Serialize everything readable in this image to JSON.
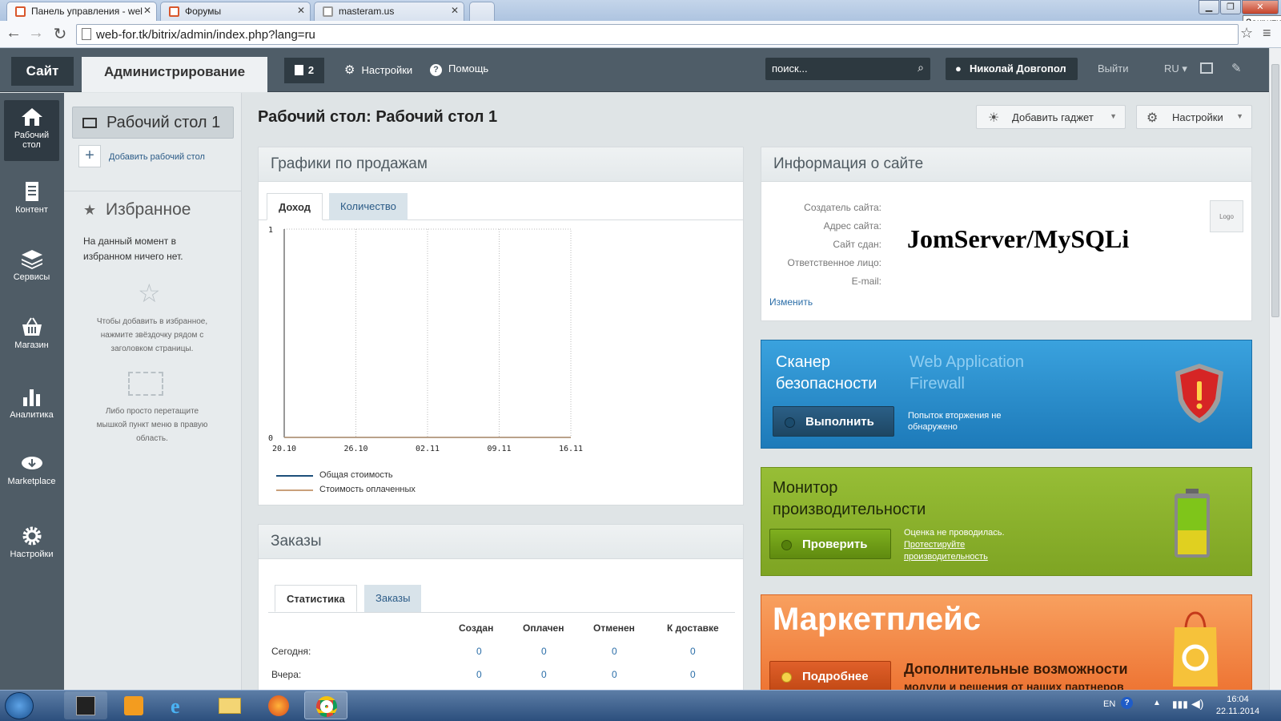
{
  "browser": {
    "tabs": [
      {
        "label": "Панель управления - wel",
        "close": "✕"
      },
      {
        "label": "Форумы",
        "close": "✕"
      },
      {
        "label": "masteram.us",
        "close": "✕"
      }
    ],
    "url": "web-for.tk/bitrix/admin/index.php?lang=ru",
    "close_tooltip": "Закрити"
  },
  "topbar": {
    "site_button": "Сайт",
    "admin_tab": "Администрирование",
    "notifications_count": "2",
    "settings": "Настройки",
    "help": "Помощь",
    "search_placeholder": "поиск...",
    "user": "Николай Довгопол",
    "logout": "Выйти",
    "language": "RU"
  },
  "leftnav": [
    {
      "label": "Рабочий стол",
      "icon": "home-icon"
    },
    {
      "label": "Контент",
      "icon": "document-icon"
    },
    {
      "label": "Сервисы",
      "icon": "layers-icon"
    },
    {
      "label": "Магазин",
      "icon": "basket-icon"
    },
    {
      "label": "Аналитика",
      "icon": "bar-chart-icon"
    },
    {
      "label": "Marketplace",
      "icon": "cloud-download-icon"
    },
    {
      "label": "Настройки",
      "icon": "gear-icon"
    }
  ],
  "desktops": {
    "current": "Рабочий стол 1",
    "add_label": "Добавить рабочий стол"
  },
  "favorites": {
    "title": "Избранное",
    "empty_text": "На данный момент в избранном ничего нет.",
    "hint1": "Чтобы добавить в избранное, нажмите звёздочку рядом с заголовком страницы.",
    "hint2": "Либо просто перетащите мышкой пункт меню в правую область."
  },
  "main": {
    "title": "Рабочий стол: Рабочий стол 1",
    "add_gadget": "Добавить гаджет",
    "settings": "Настройки"
  },
  "sales": {
    "title": "Графики по продажам",
    "tabs": [
      "Доход",
      "Количество"
    ],
    "legend": [
      "Общая стоимость",
      "Стоимость оплаченных"
    ]
  },
  "chart_data": {
    "type": "line",
    "x": [
      "20.10",
      "26.10",
      "02.11",
      "09.11",
      "16.11"
    ],
    "ylim": [
      0,
      1
    ],
    "yticks": [
      "0",
      "1"
    ],
    "series": [
      {
        "name": "Общая стоимость",
        "color": "#1d4f7a",
        "values": [
          0,
          0,
          0,
          0,
          0
        ]
      },
      {
        "name": "Стоимость оплаченных",
        "color": "#c9a07a",
        "values": [
          0,
          0,
          0,
          0,
          0
        ]
      }
    ]
  },
  "orders": {
    "title": "Заказы",
    "tabs": [
      "Статистика",
      "Заказы"
    ],
    "columns": [
      "Создан",
      "Оплачен",
      "Отменен",
      "К доставке"
    ],
    "rows": [
      {
        "label": "Сегодня:",
        "values": [
          "0",
          "0",
          "0",
          "0"
        ]
      },
      {
        "label": "Вчера:",
        "values": [
          "0",
          "0",
          "0",
          "0"
        ]
      }
    ]
  },
  "siteinfo": {
    "title": "Информация о сайте",
    "fields": [
      "Создатель сайта:",
      "Адрес сайта:",
      "Сайт сдан:",
      "Ответственное лицо:",
      "E-mail:"
    ],
    "overlay_text": "JomServer/MySQLi",
    "edit": "Изменить",
    "logo": "Logo"
  },
  "security": {
    "title": "Сканер безопасности",
    "subtitle": "Web Application Firewall",
    "button": "Выполнить",
    "status": "Попыток вторжения не обнаружено",
    "color": "#2a8fcf"
  },
  "performance": {
    "title": "Монитор производительности",
    "button": "Проверить",
    "status": "Оценка не проводилась.",
    "link": "Протестируйте производительность",
    "color": "#87b02a"
  },
  "marketplace": {
    "title": "Маркетплейс",
    "button": "Подробнее",
    "text1": "Дополнительные возможности",
    "text2": "модули и решения от наших партнеров",
    "color": "#f0813f"
  },
  "taskbar": {
    "lang": "EN",
    "time": "16:04",
    "date": "22.11.2014"
  }
}
